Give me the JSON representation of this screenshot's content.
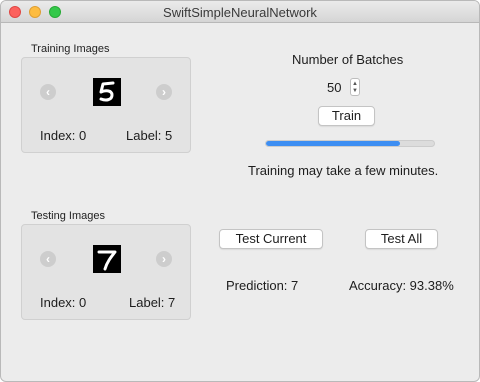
{
  "window": {
    "title": "SwiftSimpleNeuralNetwork"
  },
  "training": {
    "group_label": "Training Images",
    "prev_icon": "chevron-left-icon",
    "next_icon": "chevron-right-icon",
    "digit": "5",
    "index_text": "Index: 0",
    "label_text": "Label: 5"
  },
  "testing": {
    "group_label": "Testing Images",
    "prev_icon": "chevron-left-icon",
    "next_icon": "chevron-right-icon",
    "digit": "7",
    "index_text": "Index: 0",
    "label_text": "Label: 7"
  },
  "batches": {
    "label": "Number of Batches",
    "value": "50",
    "train_button": "Train",
    "progress_fraction": 0.8,
    "progress_color": "#3d8ef2",
    "status": "Training may take a few minutes."
  },
  "testing_controls": {
    "test_current_button": "Test Current",
    "test_all_button": "Test All",
    "prediction_text": "Prediction: 7",
    "accuracy_text": "Accuracy: 93.38%"
  }
}
